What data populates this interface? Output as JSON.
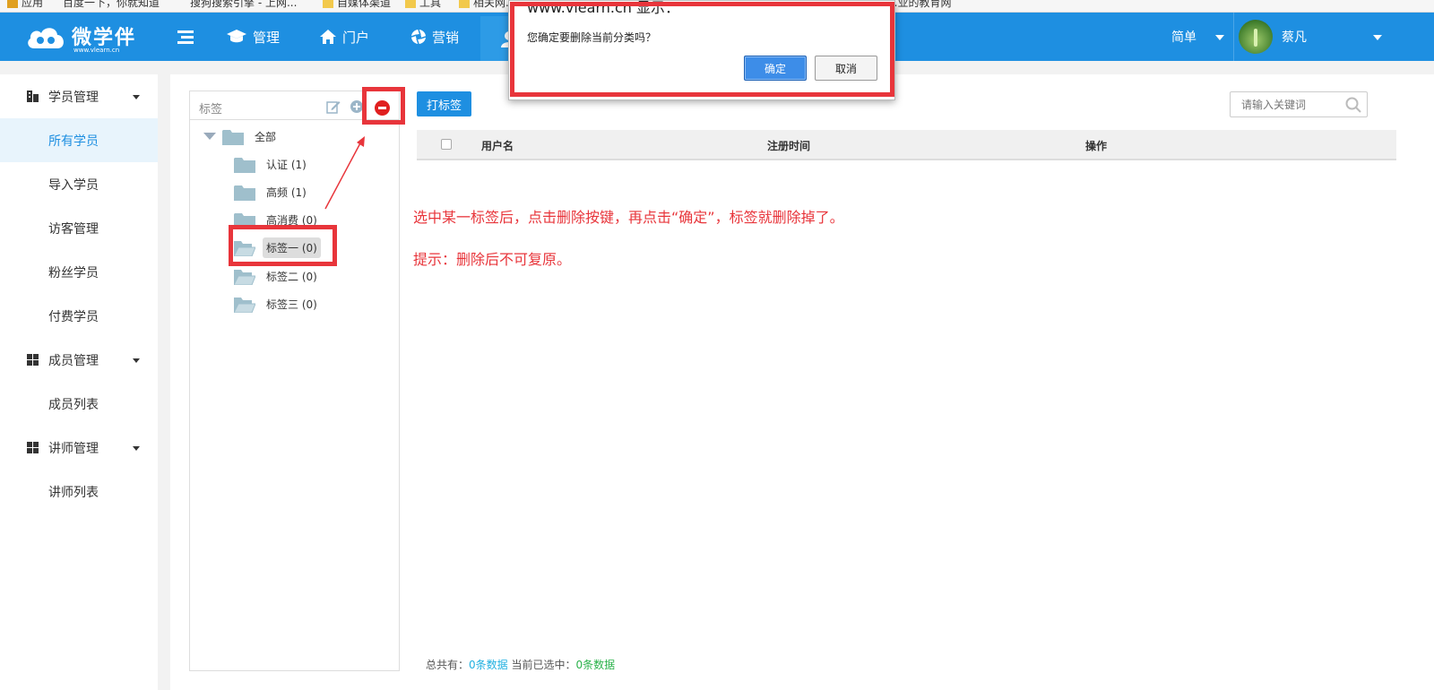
{
  "browser": {
    "bookmarks": [
      "应用",
      "百度一下，你就知道",
      "搜狗搜索引擎 - 上网...",
      "自媒体渠道",
      "工具",
      "相关网...",
      "...业的教育网"
    ]
  },
  "navbar": {
    "logo_text": "微学伴",
    "logo_sub": "www.vlearn.cn",
    "items": [
      "管理",
      "门户",
      "营销"
    ],
    "mode_label": "简单",
    "user_name": "蔡凡",
    "bg_color": "#1e8fe1"
  },
  "sidebar": {
    "groups": [
      {
        "label": "学员管理",
        "items": [
          "所有学员",
          "导入学员",
          "访客管理",
          "粉丝学员",
          "付费学员"
        ]
      },
      {
        "label": "成员管理",
        "items": [
          "成员列表"
        ]
      },
      {
        "label": "讲师管理",
        "items": [
          "讲师列表"
        ]
      }
    ],
    "active_item": "所有学员"
  },
  "tree": {
    "title": "标签",
    "root": "全部",
    "nodes": [
      "认证 (1)",
      "高频 (1)",
      "高消费 (0)",
      "标签一 (0)",
      "标签二 (0)",
      "标签三 (0)"
    ],
    "selected": "标签一 (0)"
  },
  "toolbar": {
    "tag_button": "打标签",
    "search_placeholder": "请输入关键词"
  },
  "table": {
    "columns": [
      "用户名",
      "注册时间",
      "操作"
    ]
  },
  "notes": {
    "line1": "选中某一标签后，点击删除按键，再点击“确定”，标签就删除掉了。",
    "line2": "提示：删除后不可复原。"
  },
  "footer": {
    "total_label": "总共有：",
    "total_value": "0条数据",
    "selected_label": "当前已选中：",
    "selected_value": "0条数据"
  },
  "dialog": {
    "title": "www.vlearn.cn 显示：",
    "message": "您确定要删除当前分类吗？",
    "ok": "确定",
    "cancel": "取消"
  },
  "colors": {
    "accent": "#1e8fe1",
    "annotation": "#e8353b",
    "delete_icon": "#e02020"
  }
}
